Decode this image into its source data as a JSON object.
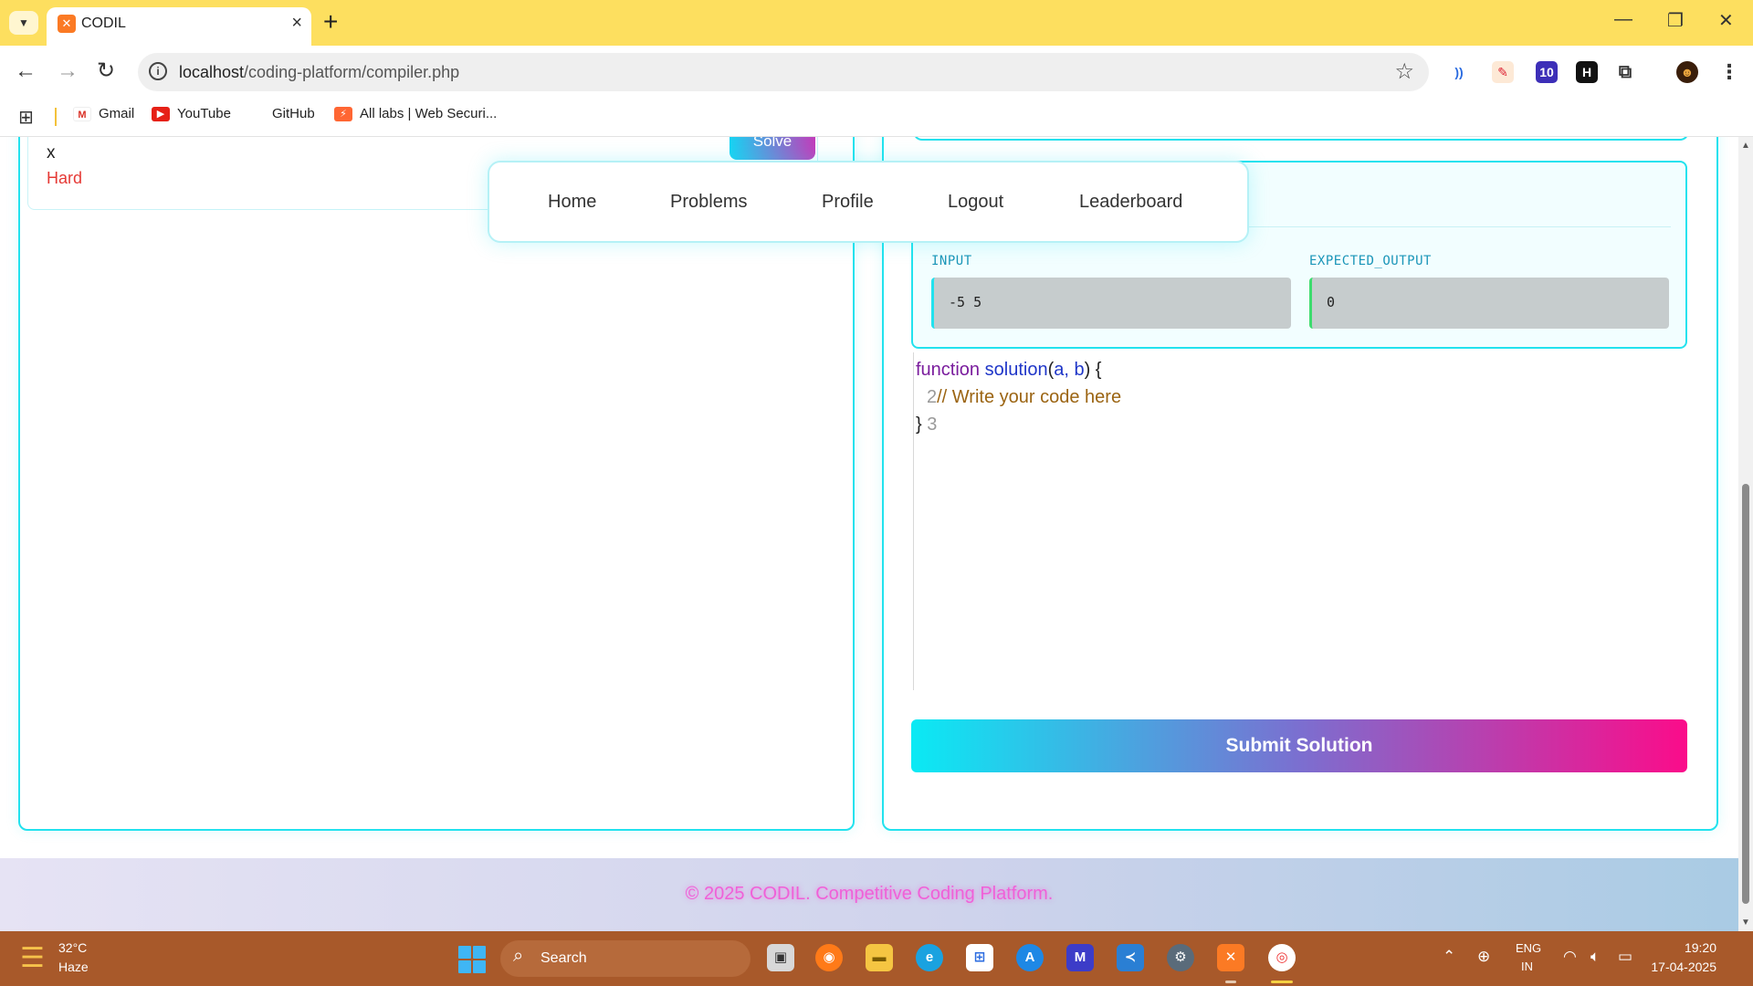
{
  "browser": {
    "tab_title": "CODIL",
    "url_host": "localhost",
    "url_path": "/coding-platform/compiler.php",
    "bookmarks": [
      "Gmail",
      "YouTube",
      "GitHub",
      "All labs | Web Securi..."
    ]
  },
  "problem": {
    "title": "x",
    "difficulty": "Hard",
    "solve_label": "Solve"
  },
  "navbar": {
    "items": [
      "Home",
      "Problems",
      "Profile",
      "Logout",
      "Leaderboard"
    ]
  },
  "testcase": {
    "input_label": "INPUT",
    "input_value": "-5 5",
    "output_label": "EXPECTED_OUTPUT",
    "output_value": "0"
  },
  "editor": {
    "line1_keyword": "function",
    "line1_name": "solution",
    "line1_params": "a, b",
    "line2_num": "2",
    "line2_comment": "// Write your code here",
    "line3_brace": "}",
    "line3_num": "3"
  },
  "submit_label": "Submit Solution",
  "footer_text": "© 2025 CODIL. Competitive Coding Platform.",
  "taskbar": {
    "temperature": "32°C",
    "weather": "Haze",
    "search_placeholder": "Search",
    "lang_line1": "ENG",
    "lang_line2": "IN",
    "time": "19:20",
    "date": "17-04-2025"
  },
  "colors": {
    "accent_cyan": "#22e2ee",
    "accent_pink": "#fb0c8a",
    "difficulty_hard": "#e53935",
    "tabbar": "#fddf5f"
  }
}
